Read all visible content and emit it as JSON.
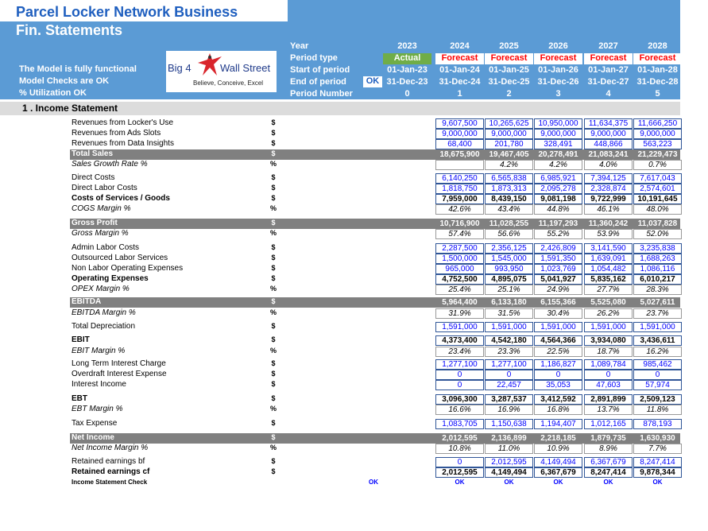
{
  "header": {
    "title": "Parcel Locker Network Business",
    "subtitle": "Fin. Statements",
    "status": [
      "The Model is fully functional",
      "Model Checks are OK",
      "% Utilization OK"
    ],
    "row_labels": [
      "Year",
      "Period type",
      "Start of period",
      "End of period",
      "Period Number"
    ],
    "ok_badge": "OK",
    "years": [
      "2023",
      "2024",
      "2025",
      "2026",
      "2027",
      "2028"
    ],
    "period_types": [
      "Actual",
      "Forecast",
      "Forecast",
      "Forecast",
      "Forecast",
      "Forecast"
    ],
    "starts": [
      "01-Jan-23",
      "01-Jan-24",
      "01-Jan-25",
      "01-Jan-26",
      "01-Jan-27",
      "01-Jan-28"
    ],
    "ends": [
      "31-Dec-23",
      "31-Dec-24",
      "31-Dec-25",
      "31-Dec-26",
      "31-Dec-27",
      "31-Dec-28"
    ],
    "period_numbers": [
      "0",
      "1",
      "2",
      "3",
      "4",
      "5"
    ],
    "colors": {
      "header_blue": "#5b9bd5",
      "actual_green": "#70ad47",
      "forecast_red": "#ff0000",
      "grey_band": "#808080",
      "input_blue": "#0000ff"
    }
  },
  "logo": {
    "left": "Big 4",
    "right": "Wall Street",
    "tagline": "Believe, Conceive, Excel",
    "icon": "eagle-icon"
  },
  "section_title": "1 . Income Statement",
  "rows": [
    {
      "label": "Revenues from Locker's Use",
      "unit": "$",
      "values": [
        "9,607,500",
        "10,265,625",
        "10,950,000",
        "11,634,375",
        "11,666,250"
      ],
      "style": "input"
    },
    {
      "label": "Revenues from Ads Slots",
      "unit": "$",
      "values": [
        "9,000,000",
        "9,000,000",
        "9,000,000",
        "9,000,000",
        "9,000,000"
      ],
      "style": "input"
    },
    {
      "label": "Revenues from Data Insights",
      "unit": "$",
      "values": [
        "68,400",
        "201,780",
        "328,491",
        "448,866",
        "563,223"
      ],
      "style": "input"
    },
    {
      "label": "Total Sales",
      "unit": "$",
      "values": [
        "18,675,900",
        "19,467,405",
        "20,278,491",
        "21,083,241",
        "21,229,473"
      ],
      "style": "total"
    },
    {
      "label": "Sales Growth Rate %",
      "unit": "%",
      "values": [
        "",
        "4.2%",
        "4.2%",
        "4.0%",
        "0.7%"
      ],
      "style": "pct"
    },
    {
      "label": "Direct Costs",
      "unit": "$",
      "values": [
        "6,140,250",
        "6,565,838",
        "6,985,921",
        "7,394,125",
        "7,617,043"
      ],
      "style": "input"
    },
    {
      "label": "Direct Labor Costs",
      "unit": "$",
      "values": [
        "1,818,750",
        "1,873,313",
        "2,095,278",
        "2,328,874",
        "2,574,601"
      ],
      "style": "input"
    },
    {
      "label": "Costs of Services / Goods",
      "unit": "$",
      "values": [
        "7,959,000",
        "8,439,150",
        "9,081,198",
        "9,722,999",
        "10,191,645"
      ],
      "style": "bold"
    },
    {
      "label": "COGS Margin %",
      "unit": "%",
      "values": [
        "42.6%",
        "43.4%",
        "44.8%",
        "46.1%",
        "48.0%"
      ],
      "style": "pct"
    },
    {
      "label": "Gross Profit",
      "unit": "$",
      "values": [
        "10,716,900",
        "11,028,255",
        "11,197,293",
        "11,360,242",
        "11,037,828"
      ],
      "style": "total"
    },
    {
      "label": "Gross Margin %",
      "unit": "%",
      "values": [
        "57.4%",
        "56.6%",
        "55.2%",
        "53.9%",
        "52.0%"
      ],
      "style": "pct"
    },
    {
      "label": "Admin Labor Costs",
      "unit": "$",
      "values": [
        "2,287,500",
        "2,356,125",
        "2,426,809",
        "3,141,590",
        "3,235,838"
      ],
      "style": "input"
    },
    {
      "label": "Outsourced Labor Services",
      "unit": "$",
      "values": [
        "1,500,000",
        "1,545,000",
        "1,591,350",
        "1,639,091",
        "1,688,263"
      ],
      "style": "input"
    },
    {
      "label": "Non Labor Operating Expenses",
      "unit": "$",
      "values": [
        "965,000",
        "993,950",
        "1,023,769",
        "1,054,482",
        "1,086,116"
      ],
      "style": "input"
    },
    {
      "label": "Operating Expenses",
      "unit": "$",
      "values": [
        "4,752,500",
        "4,895,075",
        "5,041,927",
        "5,835,162",
        "6,010,217"
      ],
      "style": "bold"
    },
    {
      "label": "OPEX Margin %",
      "unit": "%",
      "values": [
        "25.4%",
        "25.1%",
        "24.9%",
        "27.7%",
        "28.3%"
      ],
      "style": "pct"
    },
    {
      "label": "EBITDA",
      "unit": "$",
      "values": [
        "5,964,400",
        "6,133,180",
        "6,155,366",
        "5,525,080",
        "5,027,611"
      ],
      "style": "total"
    },
    {
      "label": "EBITDA Margin %",
      "unit": "%",
      "values": [
        "31.9%",
        "31.5%",
        "30.4%",
        "26.2%",
        "23.7%"
      ],
      "style": "pct"
    },
    {
      "label": "Total Depreciation",
      "unit": "$",
      "values": [
        "1,591,000",
        "1,591,000",
        "1,591,000",
        "1,591,000",
        "1,591,000"
      ],
      "style": "input"
    },
    {
      "label": "EBIT",
      "unit": "$",
      "values": [
        "4,373,400",
        "4,542,180",
        "4,564,366",
        "3,934,080",
        "3,436,611"
      ],
      "style": "bold"
    },
    {
      "label": "EBIT Margin %",
      "unit": "%",
      "values": [
        "23.4%",
        "23.3%",
        "22.5%",
        "18.7%",
        "16.2%"
      ],
      "style": "pct"
    },
    {
      "label": "Long Term Interest Charge",
      "unit": "$",
      "values": [
        "1,277,100",
        "1,277,100",
        "1,186,827",
        "1,089,784",
        "985,462"
      ],
      "style": "input"
    },
    {
      "label": "Overdraft Interest Expense",
      "unit": "$",
      "values": [
        "0",
        "0",
        "0",
        "0",
        "0"
      ],
      "style": "input"
    },
    {
      "label": "Interest Income",
      "unit": "$",
      "values": [
        "0",
        "22,457",
        "35,053",
        "47,603",
        "57,974"
      ],
      "style": "input"
    },
    {
      "label": "EBT",
      "unit": "$",
      "values": [
        "3,096,300",
        "3,287,537",
        "3,412,592",
        "2,891,899",
        "2,509,123"
      ],
      "style": "bold"
    },
    {
      "label": "EBT Margin %",
      "unit": "%",
      "values": [
        "16.6%",
        "16.9%",
        "16.8%",
        "13.7%",
        "11.8%"
      ],
      "style": "pct"
    },
    {
      "label": "Tax Expense",
      "unit": "$",
      "values": [
        "1,083,705",
        "1,150,638",
        "1,194,407",
        "1,012,165",
        "878,193"
      ],
      "style": "input"
    },
    {
      "label": "Net Income",
      "unit": "$",
      "values": [
        "2,012,595",
        "2,136,899",
        "2,218,185",
        "1,879,735",
        "1,630,930"
      ],
      "style": "total"
    },
    {
      "label": "Net Income Margin %",
      "unit": "%",
      "values": [
        "10.8%",
        "11.0%",
        "10.9%",
        "8.9%",
        "7.7%"
      ],
      "style": "pct"
    },
    {
      "label": "Retained earnings bf",
      "unit": "$",
      "values": [
        "0",
        "2,012,595",
        "4,149,494",
        "6,367,679",
        "8,247,414"
      ],
      "style": "input"
    },
    {
      "label": "Retained earnings cf",
      "unit": "$",
      "values": [
        "2,012,595",
        "4,149,494",
        "6,367,679",
        "8,247,414",
        "9,878,344"
      ],
      "style": "bold"
    },
    {
      "label": "Income Statement Check",
      "unit": "",
      "values": [
        "OK",
        "OK",
        "OK",
        "OK",
        "OK"
      ],
      "style": "check",
      "actual_ok": "OK"
    }
  ]
}
